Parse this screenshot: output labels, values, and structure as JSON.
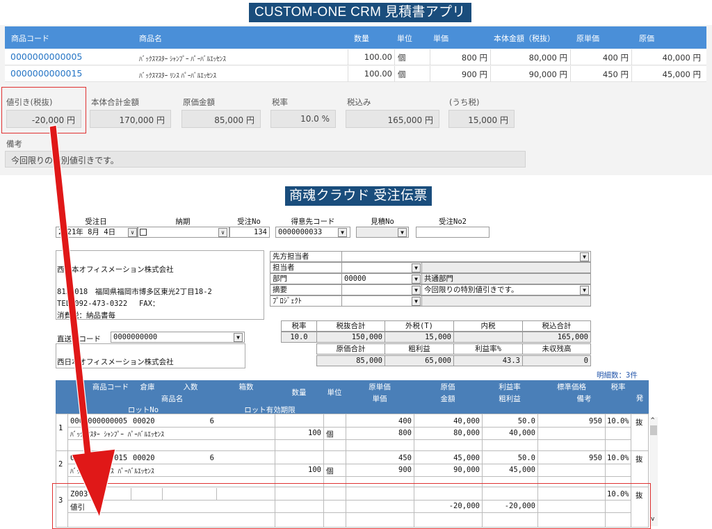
{
  "crm": {
    "banner": "CUSTOM-ONE CRM 見積書アプリ",
    "columns": [
      "商品コード",
      "商品名",
      "数量",
      "単位",
      "単価",
      "本体金額（税抜）",
      "原単価",
      "原価"
    ],
    "rows": [
      {
        "code": "0000000000005",
        "name": "ﾊﾞｯｸｽﾏｽﾀｰ ｼｬﾝﾌﾟｰ ﾊﾟｰﾊﾞﾙｴｯｾﾝｽ",
        "qty": "100.00",
        "unit": "個",
        "price": "800 円",
        "amount": "80,000 円",
        "cost_unit": "400 円",
        "cost": "40,000 円"
      },
      {
        "code": "0000000000015",
        "name": "ﾊﾞｯｸｽﾏｽﾀｰ ﾘﾝｽ ﾊﾟｰﾊﾞﾙｴｯｾﾝｽ",
        "qty": "100.00",
        "unit": "個",
        "price": "900 円",
        "amount": "90,000 円",
        "cost_unit": "450 円",
        "cost": "45,000 円"
      }
    ],
    "summary": {
      "discount_label": "値引き(税抜)",
      "discount": "-20,000 円",
      "total_label": "本体合計金額",
      "total": "170,000 円",
      "cost_label": "原価金額",
      "cost": "85,000 円",
      "taxrate_label": "税率",
      "taxrate": "10.0 %",
      "taxin_label": "税込み",
      "taxin": "165,000 円",
      "taxof_label": "(うち税)",
      "taxof": "15,000 円"
    },
    "remarks_label": "備考",
    "remarks": "今回限りの特別値引きです。"
  },
  "sk": {
    "banner": "商魂クラウド 受注伝票",
    "header_labels": {
      "date": "受注日",
      "delivery": "納期",
      "order_no": "受注No",
      "customer_code": "得意先コード",
      "estimate_no": "見積No",
      "order_no2": "受注No2"
    },
    "header_values": {
      "date": "2021年 8月 4日",
      "order_no": "134",
      "customer_code": "0000000033",
      "estimate_no": "",
      "order_no2": ""
    },
    "customer": {
      "name": "西日本オフィスメーション株式会社",
      "address": "8120018　福岡県福岡市博多区東光2丁目18-2",
      "tel": "TEL 092-473-0322　 FAX：",
      "tax": "消費税：納品書毎"
    },
    "info_labels": {
      "rep_contact": "先方担当者",
      "staff": "担当者",
      "dept": "部門",
      "summary": "摘要",
      "project": "ﾌﾟﾛｼﾞｪｸﾄ"
    },
    "info_values": {
      "rep_contact": "",
      "staff": "",
      "dept_code": "00000",
      "dept_name": "共通部門",
      "summary": "今回限りの特別値引きです。",
      "project": ""
    },
    "totals_labels": [
      "税率",
      "税抜合計",
      "外税(T)",
      "内税",
      "税込合計"
    ],
    "totals_values": [
      "10.0",
      "150,000",
      "15,000",
      "",
      "165,000"
    ],
    "totals_labels2": [
      "原価合計",
      "粗利益",
      "利益率%",
      "未収残高"
    ],
    "totals_values2": [
      "85,000",
      "65,000",
      "43.3",
      "0"
    ],
    "direct_label": "直送先コード",
    "direct_code": "0000000000",
    "direct_name": "西日本オフィスメーション株式会社",
    "count_label": "明細数：3件",
    "grid_headers": {
      "code": "商品コード",
      "warehouse": "倉庫",
      "pack": "入数",
      "boxes": "箱数",
      "name": "商品名",
      "lot": "ロットNo",
      "lot_exp": "ロット有効期限",
      "qty": "数量",
      "unit": "単位",
      "cost_unit": "原単価",
      "unit_price": "単価",
      "cost": "原価",
      "amount": "金額",
      "margin_rate": "利益率",
      "gross": "粗利益",
      "std_price": "標準価格",
      "note": "備考",
      "taxrate": "税率",
      "ship": "発"
    },
    "lines": [
      {
        "no": "1",
        "code": "0000000000005",
        "warehouse": "00020",
        "pack": "6",
        "name": "ﾊﾞｯｸｽﾏｽﾀｰ ｼｬﾝﾌﾟｰ ﾊﾟｰﾊﾞﾙｴｯｾﾝｽ",
        "qty": "100",
        "unit": "個",
        "cost_unit": "400",
        "unit_price": "800",
        "cost": "40,000",
        "amount": "80,000",
        "margin": "50.0",
        "gross": "40,000",
        "std": "950",
        "tax": "10.0%",
        "taxflag": "抜"
      },
      {
        "no": "2",
        "code": "0000000000015",
        "warehouse": "00020",
        "pack": "6",
        "name": "ﾊﾞｯｸｽﾏｽﾀｰ ﾘﾝｽ ﾊﾟｰﾊﾞﾙｴｯｾﾝｽ",
        "qty": "100",
        "unit": "個",
        "cost_unit": "450",
        "unit_price": "900",
        "cost": "45,000",
        "amount": "90,000",
        "margin": "50.0",
        "gross": "45,000",
        "std": "950",
        "tax": "10.0%",
        "taxflag": "抜"
      },
      {
        "no": "3",
        "code": "Z003",
        "warehouse": "",
        "pack": "",
        "name": "値引",
        "qty": "",
        "unit": "",
        "cost_unit": "",
        "unit_price": "",
        "cost": "",
        "amount": "-20,000",
        "margin": "",
        "gross": "-20,000",
        "std": "",
        "tax": "10.0%",
        "taxflag": "抜"
      }
    ]
  },
  "colors": {
    "crm_header": "#4a8fd8",
    "banner": "#1a4d7c",
    "grid_header": "#4a7fb8",
    "highlight": "#e03030",
    "arrow": "#e01818"
  }
}
